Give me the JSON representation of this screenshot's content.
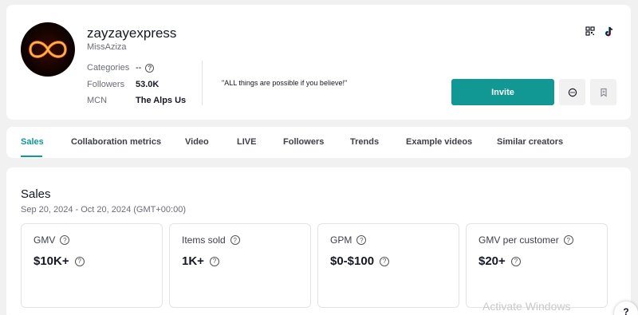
{
  "profile": {
    "username": "zayzayexpress",
    "nickname": "MissAziza",
    "categories_label": "Categories",
    "categories_value": "--",
    "followers_label": "Followers",
    "followers_value": "53.0K",
    "mcn_label": "MCN",
    "mcn_value": "The Alps Us",
    "bio": "\"ALL things are possible if you believe!\"",
    "invite_label": "Invite"
  },
  "tabs": [
    "Sales",
    "Collaboration metrics",
    "Video",
    "LIVE",
    "Followers",
    "Trends",
    "Example videos",
    "Similar creators"
  ],
  "active_tab": "Sales",
  "sales": {
    "title": "Sales",
    "date_range": "Sep 20, 2024 - Oct 20, 2024 (GMT+00:00)",
    "metrics": [
      {
        "label": "GMV",
        "value": "$10K+"
      },
      {
        "label": "Items sold",
        "value": "1K+"
      },
      {
        "label": "GPM",
        "value": "$0-$100"
      },
      {
        "label": "GMV per customer",
        "value": "$20+"
      }
    ]
  },
  "watermark": "Activate Windows",
  "colors": {
    "accent": "#119894",
    "text": "#161823",
    "muted": "#6b6d75",
    "page_bg": "#f1f1f2"
  }
}
